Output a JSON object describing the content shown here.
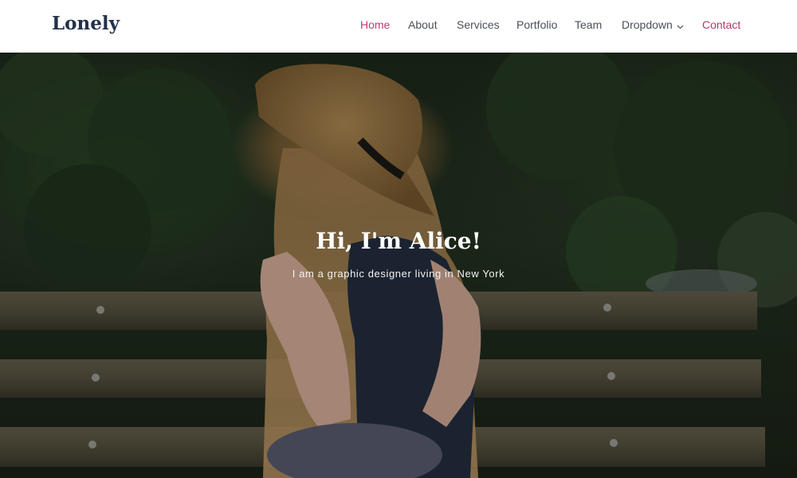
{
  "header": {
    "logo": "Lonely",
    "nav": [
      {
        "label": "Home",
        "active": true
      },
      {
        "label": "About"
      },
      {
        "label": "Services"
      },
      {
        "label": "Portfolio"
      },
      {
        "label": "Team"
      },
      {
        "label": "Dropdown",
        "has_submenu": true
      },
      {
        "label": "Contact"
      }
    ],
    "chevron_icon": "chevron-down-icon"
  },
  "hero": {
    "title": "Hi, I'm Alice!",
    "subtitle": "I am a graphic designer living in New York",
    "background_image": "woman-in-straw-hat-on-park-bench"
  },
  "colors": {
    "accent": "#c23a73",
    "logo": "#243047",
    "nav_text": "#4a5058",
    "header_bg": "#ffffff"
  }
}
